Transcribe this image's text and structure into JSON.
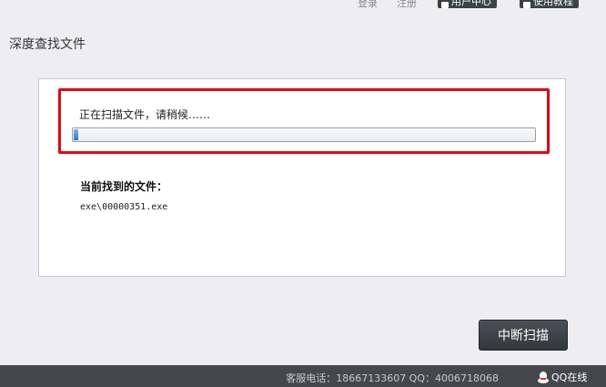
{
  "topbar": {
    "login_label": "登录",
    "register_label": "注册",
    "user_center_label": "用户中心",
    "tutorial_label": "使用教程"
  },
  "page_title": "深度查找文件",
  "scan": {
    "status_text": "正在扫描文件，请稍候……",
    "progress_percent": 1,
    "found_label": "当前找到的文件：",
    "current_file": "exe\\00000351.exe"
  },
  "actions": {
    "stop_scan_label": "中断扫描"
  },
  "footer": {
    "contact_text": "客服电话：18667133607 QQ：4006718068",
    "qq_online_label": "QQ在线"
  },
  "colors": {
    "highlight": "#d0111b",
    "progress_fill": "#2f78c8",
    "button_bg": "#3d4148",
    "footer_bg": "#45474d"
  }
}
